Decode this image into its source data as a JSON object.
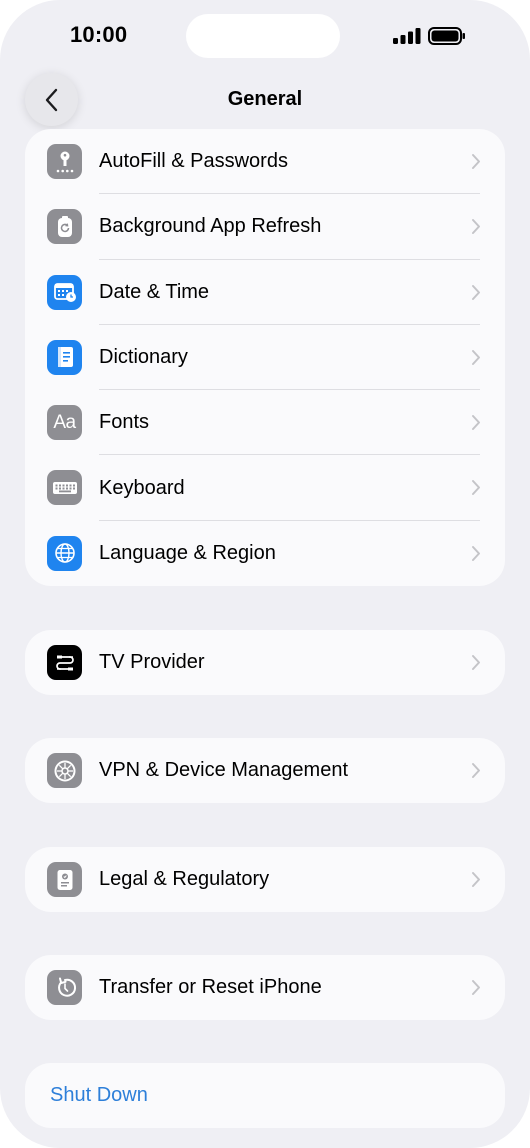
{
  "status_bar": {
    "time": "10:00"
  },
  "nav": {
    "title": "General",
    "back_icon": "chevron-left-icon"
  },
  "groups": [
    {
      "items": [
        {
          "label": "AutoFill & Passwords",
          "icon": "key-icon",
          "color": "#8e8e93"
        },
        {
          "label": "Background App Refresh",
          "icon": "refresh-icon",
          "color": "#8e8e93"
        },
        {
          "label": "Date & Time",
          "icon": "calendar-clock-icon",
          "color": "#1f84ef"
        },
        {
          "label": "Dictionary",
          "icon": "book-icon",
          "color": "#1f84ef"
        },
        {
          "label": "Fonts",
          "icon": "fonts-icon",
          "color": "#8e8e93"
        },
        {
          "label": "Keyboard",
          "icon": "keyboard-icon",
          "color": "#8e8e93"
        },
        {
          "label": "Language & Region",
          "icon": "globe-icon",
          "color": "#1f84ef"
        }
      ]
    },
    {
      "items": [
        {
          "label": "TV Provider",
          "icon": "tv-provider-icon",
          "color": "#000000"
        }
      ]
    },
    {
      "items": [
        {
          "label": "VPN & Device Management",
          "icon": "gear-icon",
          "color": "#8e8e93"
        }
      ]
    },
    {
      "items": [
        {
          "label": "Legal & Regulatory",
          "icon": "document-icon",
          "color": "#8e8e93"
        }
      ]
    },
    {
      "items": [
        {
          "label": "Transfer or Reset iPhone",
          "icon": "reset-icon",
          "color": "#8e8e93"
        }
      ]
    }
  ],
  "shut_down": {
    "label": "Shut Down",
    "color": "#2d7fd9"
  }
}
